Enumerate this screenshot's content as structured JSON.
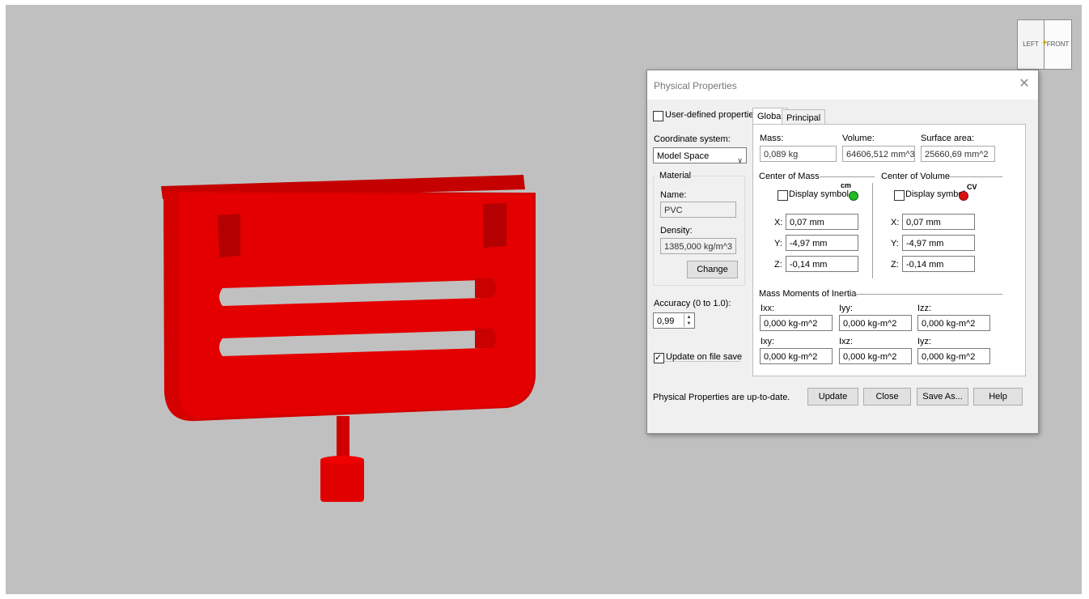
{
  "viewcube": {
    "left_label": "LEFT",
    "front_label": "FRONT"
  },
  "colors": {
    "model": "#e00000",
    "viewport_bg": "#c0c0c0",
    "cm_symbol": "#22bb22",
    "cv_symbol": "#dd1010"
  },
  "dialog": {
    "title": "Physical Properties",
    "close_glyph": "✕",
    "user_defined_label": "User-defined properties",
    "user_defined_checked": false,
    "coordinate_system_label": "Coordinate system:",
    "coordinate_system_value": "Model Space",
    "material_group_label": "Material",
    "name_label": "Name:",
    "name_value": "PVC",
    "density_label": "Density:",
    "density_value": "1385,000 kg/m^3",
    "change_button": "Change",
    "accuracy_label": "Accuracy (0 to 1.0):",
    "accuracy_value": "0,99",
    "update_on_save_label": "Update on file save",
    "update_on_save_checked": true,
    "tabs": [
      "Global",
      "Principal"
    ],
    "global": {
      "mass_label": "Mass:",
      "mass_value": "0,089 kg",
      "volume_label": "Volume:",
      "volume_value": "64606,512 mm^3",
      "surface_label": "Surface area:",
      "surface_value": "25660,69 mm^2",
      "center_of_mass": {
        "heading": "Center of Mass",
        "display_symbol_label": "Display symbol",
        "symbol_text": "cm",
        "x_label": "X:",
        "x_value": "0,07 mm",
        "y_label": "Y:",
        "y_value": "-4,97 mm",
        "z_label": "Z:",
        "z_value": "-0,14 mm"
      },
      "center_of_volume": {
        "heading": "Center of Volume",
        "display_symbol_label": "Display symbol",
        "symbol_text": "CV",
        "x_label": "X:",
        "x_value": "0,07 mm",
        "y_label": "Y:",
        "y_value": "-4,97 mm",
        "z_label": "Z:",
        "z_value": "-0,14 mm"
      },
      "inertia": {
        "heading": "Mass Moments of Inertia",
        "ixx_label": "Ixx:",
        "ixx_value": "0,000 kg-m^2",
        "iyy_label": "Iyy:",
        "iyy_value": "0,000 kg-m^2",
        "izz_label": "Izz:",
        "izz_value": "0,000 kg-m^2",
        "ixy_label": "Ixy:",
        "ixy_value": "0,000 kg-m^2",
        "ixz_label": "Ixz:",
        "ixz_value": "0,000 kg-m^2",
        "iyz_label": "Iyz:",
        "iyz_value": "0,000 kg-m^2"
      }
    },
    "status_text": "Physical Properties are up-to-date.",
    "buttons": {
      "update": "Update",
      "close": "Close",
      "save_as": "Save As...",
      "help": "Help"
    }
  }
}
